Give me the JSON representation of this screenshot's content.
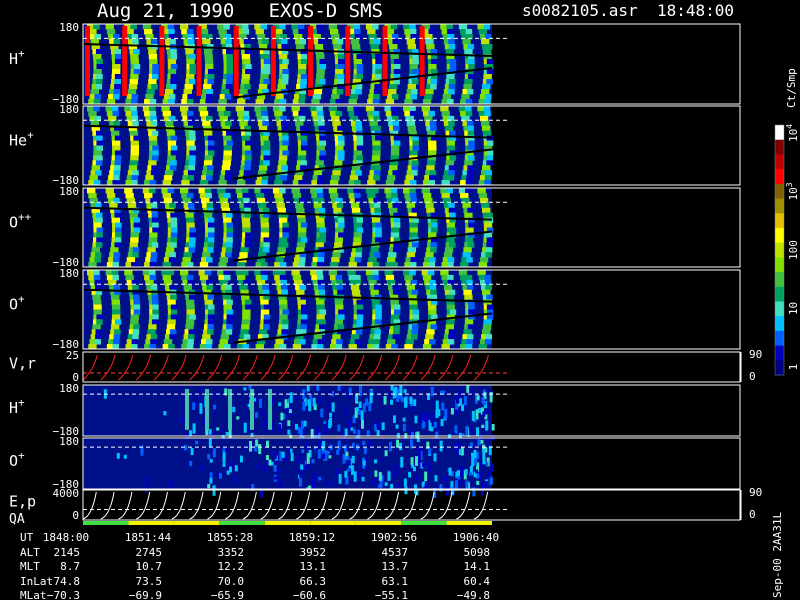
{
  "chart_data": {
    "type": "heatmap",
    "title": "Aug 21, 1990   EXOS-D SMS",
    "file_label": "s0082105.asr",
    "time_label": "18:48:00",
    "colorbar": {
      "unit": "Ct/Smp",
      "ticks": [
        {
          "label": "1",
          "value": 1
        },
        {
          "label": "10",
          "value": 10
        },
        {
          "label": "100",
          "value": 100
        },
        {
          "label": "10",
          "sup": "3",
          "value": 1000
        },
        {
          "label": "10",
          "sup": "4",
          "value": 10000
        }
      ],
      "colors": [
        "#000080",
        "#0000c0",
        "#0060ff",
        "#00c0ff",
        "#40e0c0",
        "#00a060",
        "#40c040",
        "#80e000",
        "#c0e000",
        "#ffff00",
        "#e0c000",
        "#a09000",
        "#806000",
        "#ff0000",
        "#c00000",
        "#800000",
        "#ffffff"
      ]
    },
    "panels": [
      {
        "name": "H",
        "sup": "+",
        "ymax": "180",
        "ymin": "−180",
        "kind": "pitch"
      },
      {
        "name": "He",
        "sup": "+",
        "ymax": "180",
        "ymin": "−180",
        "kind": "pitch"
      },
      {
        "name": "O",
        "sup": "++",
        "ymax": "180",
        "ymin": "−180",
        "kind": "pitch"
      },
      {
        "name": "O",
        "sup": "+",
        "ymax": "180",
        "ymin": "−180",
        "kind": "pitch"
      },
      {
        "name": "V,r",
        "sup": "",
        "ymax": "25",
        "ymin": "0",
        "right_max": "90",
        "right_min": "0",
        "kind": "line"
      },
      {
        "name": "H",
        "sup": "+",
        "ymax": "180",
        "ymin": "−180",
        "kind": "sparse"
      },
      {
        "name": "O",
        "sup": "+",
        "ymax": "180",
        "ymin": "−180",
        "kind": "sparse"
      },
      {
        "name": "E,p",
        "sup": "",
        "ymax": "4000",
        "ymin": "0",
        "right_max": "90",
        "right_min": "0",
        "kind": "energy"
      }
    ],
    "qa_label": "QA",
    "qa_segments": [
      "green",
      "yellow",
      "yellow",
      "green",
      "yellow",
      "yellow",
      "yellow",
      "green",
      "yellow"
    ],
    "ephemeris": {
      "row_labels": [
        "UT",
        "ALT",
        "MLT",
        "InLat",
        "MLat"
      ],
      "columns": [
        [
          "1848:00",
          "2145",
          "8.7",
          "74.8",
          "−70.3"
        ],
        [
          "1851:44",
          "2745",
          "10.7",
          "73.5",
          "−69.9"
        ],
        [
          "1855:28",
          "3352",
          "12.2",
          "70.0",
          "−65.9"
        ],
        [
          "1859:12",
          "3952",
          "13.1",
          "66.3",
          "−60.6"
        ],
        [
          "1902:56",
          "4537",
          "13.7",
          "63.1",
          "−55.1"
        ],
        [
          "1906:40",
          "5098",
          "14.1",
          "60.4",
          "−49.8"
        ]
      ]
    },
    "footer_label": "Sep-00 2AA31L"
  }
}
